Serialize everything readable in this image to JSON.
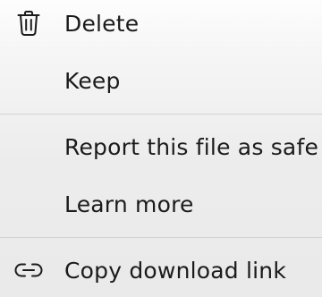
{
  "menu": {
    "items": [
      {
        "label": "Delete",
        "icon": "trash-icon"
      },
      {
        "label": "Keep"
      },
      {
        "label": "Report this file as safe"
      },
      {
        "label": "Learn more"
      },
      {
        "label": "Copy download link",
        "icon": "link-icon"
      }
    ]
  }
}
